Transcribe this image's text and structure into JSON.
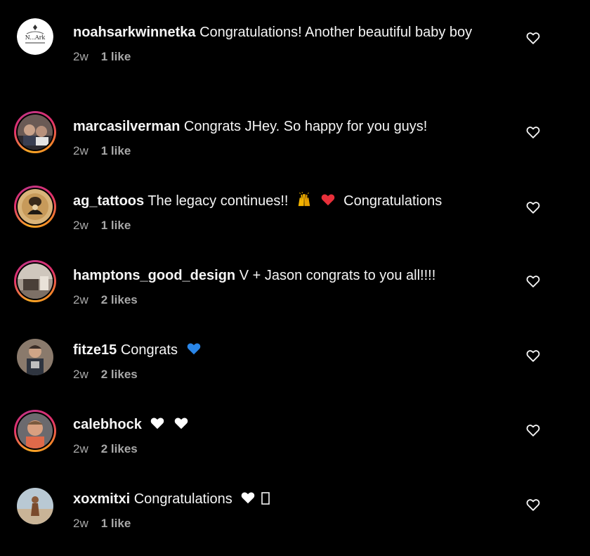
{
  "colors": {
    "background": "#000000",
    "text": "#f5f5f5",
    "meta": "#a8a8a8",
    "red_heart": "#e8303a",
    "blue_heart": "#2a86e8"
  },
  "comments": [
    {
      "username": "noahsarkwinnetka",
      "text": "Congratulations! Another beautiful baby boy",
      "time": "2w",
      "likes": "1 like",
      "avatar_logo": "N...Ark"
    },
    {
      "username": "marcasilverman",
      "text": "Congrats JHey. So happy for you guys!",
      "time": "2w",
      "likes": "1 like"
    },
    {
      "username": "ag_tattoos",
      "text": "The legacy continues!!",
      "text_after": "Congratulations",
      "time": "2w",
      "likes": "1 like",
      "emojis": [
        "raising-hands-icon",
        "red-heart-icon"
      ]
    },
    {
      "username": "hamptons_good_design",
      "text": "V + Jason congrats to you all!!!!",
      "time": "2w",
      "likes": "2 likes"
    },
    {
      "username": "fitze15",
      "text": "Congrats",
      "time": "2w",
      "likes": "2 likes",
      "emojis": [
        "blue-heart-icon"
      ]
    },
    {
      "username": "calebhock",
      "text": "",
      "time": "2w",
      "likes": "2 likes",
      "emojis": [
        "white-heart-icon",
        "white-heart-icon"
      ]
    },
    {
      "username": "xoxmitxi",
      "text": "Congratulations",
      "time": "2w",
      "likes": "1 like",
      "emojis": [
        "white-heart-icon",
        "missing-glyph-icon"
      ]
    }
  ]
}
